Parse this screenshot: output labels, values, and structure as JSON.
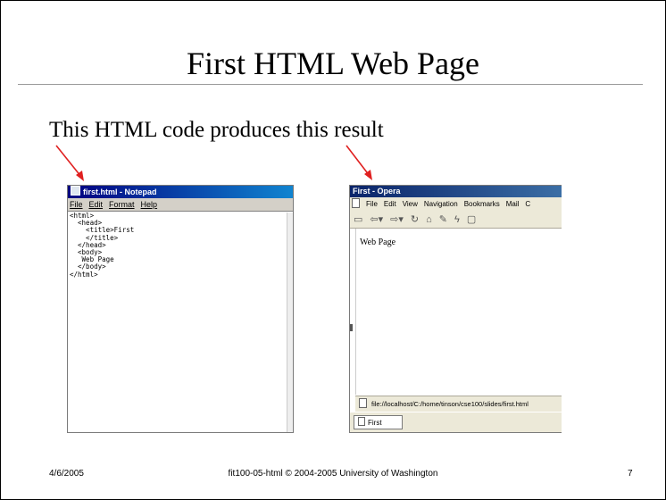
{
  "slide": {
    "title": "First HTML Web Page",
    "body_text": "This HTML code produces this result",
    "accent_arrow_color": "#e02020"
  },
  "notepad": {
    "title": "first.html - Notepad",
    "menu": [
      "File",
      "Edit",
      "Format",
      "Help"
    ],
    "code": "<html>\n  <head>\n    <title>First\n    </title>\n  </head>\n  <body>\n   Web Page\n  </body>\n</html>"
  },
  "opera": {
    "title": "First - Opera",
    "menu": [
      "File",
      "Edit",
      "View",
      "Navigation",
      "Bookmarks",
      "Mail",
      "C"
    ],
    "toolbar_icons": [
      "open-icon",
      "back-icon",
      "forward-icon",
      "reload-icon",
      "home-icon",
      "search-icon",
      "hotlist-icon",
      "save-icon"
    ],
    "page_text": "Web Page",
    "address": "file://localhost/C:/home/tinson/cse100/slides/first.html",
    "tab_label": "First"
  },
  "footer": {
    "date": "4/6/2005",
    "center": "fit100-05-html © 2004-2005 University of Washington",
    "page_number": "7"
  }
}
